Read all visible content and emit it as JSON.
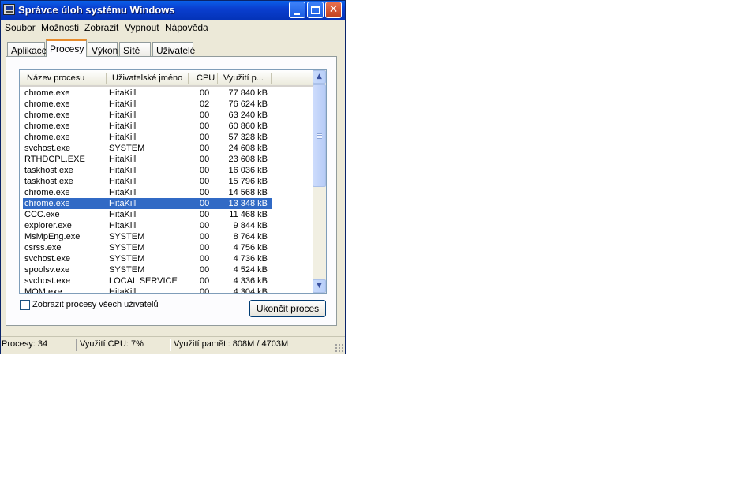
{
  "window": {
    "title": "Správce úloh systému Windows"
  },
  "menu": [
    "Soubor",
    "Možnosti",
    "Zobrazit",
    "Vypnout",
    "Nápověda"
  ],
  "tabs": [
    "Aplikace",
    "Procesy",
    "Výkon",
    "Sítě",
    "Uživatelé"
  ],
  "active_tab": "Procesy",
  "columns": [
    "Název procesu",
    "Uživatelské jméno",
    "CPU",
    "Využití p..."
  ],
  "processes": [
    {
      "name": "chrome.exe",
      "user": "HitaKill",
      "cpu": "00",
      "mem": "77 840 kB"
    },
    {
      "name": "chrome.exe",
      "user": "HitaKill",
      "cpu": "02",
      "mem": "76 624 kB"
    },
    {
      "name": "chrome.exe",
      "user": "HitaKill",
      "cpu": "00",
      "mem": "63 240 kB"
    },
    {
      "name": "chrome.exe",
      "user": "HitaKill",
      "cpu": "00",
      "mem": "60 860 kB"
    },
    {
      "name": "chrome.exe",
      "user": "HitaKill",
      "cpu": "00",
      "mem": "57 328 kB"
    },
    {
      "name": "svchost.exe",
      "user": "SYSTEM",
      "cpu": "00",
      "mem": "24 608 kB"
    },
    {
      "name": "RTHDCPL.EXE",
      "user": "HitaKill",
      "cpu": "00",
      "mem": "23 608 kB"
    },
    {
      "name": "taskhost.exe",
      "user": "HitaKill",
      "cpu": "00",
      "mem": "16 036 kB"
    },
    {
      "name": "taskhost.exe",
      "user": "HitaKill",
      "cpu": "00",
      "mem": "15 796 kB"
    },
    {
      "name": "chrome.exe",
      "user": "HitaKill",
      "cpu": "00",
      "mem": "14 568 kB"
    },
    {
      "name": "chrome.exe",
      "user": "HitaKill",
      "cpu": "00",
      "mem": "13 348 kB"
    },
    {
      "name": "CCC.exe",
      "user": "HitaKill",
      "cpu": "00",
      "mem": "11 468 kB"
    },
    {
      "name": "explorer.exe",
      "user": "HitaKill",
      "cpu": "00",
      "mem": "9 844 kB"
    },
    {
      "name": "MsMpEng.exe",
      "user": "SYSTEM",
      "cpu": "00",
      "mem": "8 764 kB"
    },
    {
      "name": "csrss.exe",
      "user": "SYSTEM",
      "cpu": "00",
      "mem": "4 756 kB"
    },
    {
      "name": "svchost.exe",
      "user": "SYSTEM",
      "cpu": "00",
      "mem": "4 736 kB"
    },
    {
      "name": "spoolsv.exe",
      "user": "SYSTEM",
      "cpu": "00",
      "mem": "4 524 kB"
    },
    {
      "name": "svchost.exe",
      "user": "LOCAL SERVICE",
      "cpu": "00",
      "mem": "4 336 kB"
    },
    {
      "name": "MOM.exe",
      "user": "HitaKill",
      "cpu": "00",
      "mem": "4 304 kB"
    }
  ],
  "selected_process": "chrome.exe",
  "show_all_label": "Zobrazit procesy všech uživatelů",
  "show_all_checked": false,
  "end_button": "Ukončit proces",
  "status": {
    "processes": "Procesy: 34",
    "cpu": "Využití CPU: 7%",
    "memory": "Využití paměti: 808M / 4703M"
  },
  "colors": {
    "title_bar": "#0a3fd0",
    "selection": "#316ac5",
    "tab_accent": "#e68b2c"
  },
  "icons": [
    "task-manager-icon",
    "minimize-icon",
    "maximize-icon",
    "close-icon",
    "scroll-up-icon",
    "scroll-down-icon",
    "resize-grip-icon"
  ]
}
